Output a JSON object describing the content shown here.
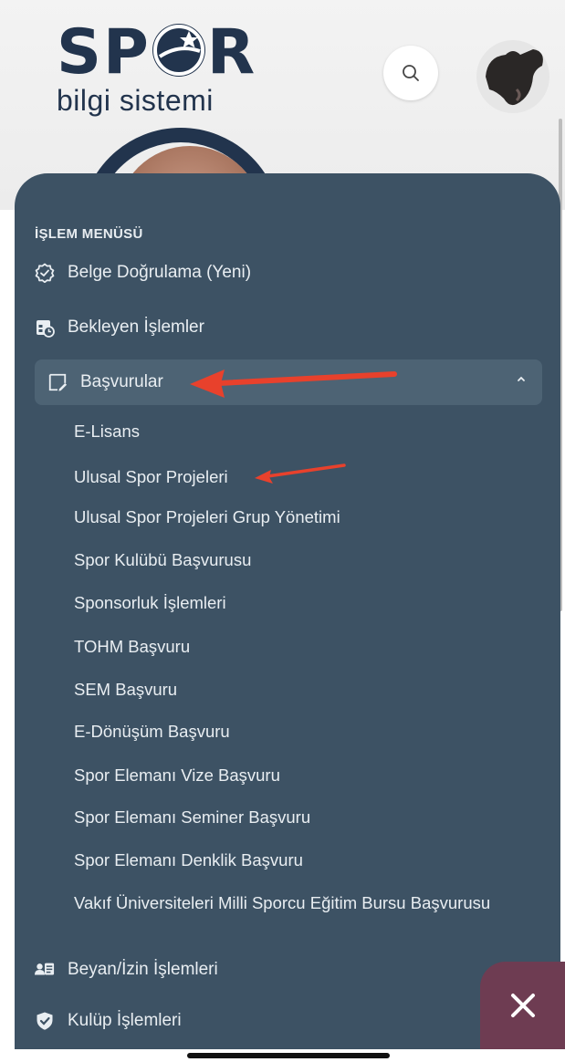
{
  "header": {
    "logo_title": "SP R",
    "logo_subtitle": "bilgi sistemi"
  },
  "menu": {
    "section_title": "İŞLEM MENÜSÜ",
    "items": [
      {
        "label": "Belge Doğrulama (Yeni)",
        "icon": "badge-check-icon"
      },
      {
        "label": "Bekleyen İşlemler",
        "icon": "calendar-clock-icon"
      },
      {
        "label": "Başvurular",
        "icon": "form-edit-icon",
        "expanded": true
      }
    ],
    "subitems": [
      "E-Lisans",
      "Ulusal Spor Projeleri",
      "Ulusal Spor Projeleri Grup Yönetimi",
      "Spor Kulübü Başvurusu",
      "Sponsorluk İşlemleri",
      "TOHM Başvuru",
      "SEM Başvuru",
      "E-Dönüşüm Başvuru",
      "Spor Elemanı Vize Başvuru",
      "Spor Elemanı Seminer Başvuru",
      "Spor Elemanı Denklik Başvuru",
      "Vakıf Üniversiteleri Milli Sporcu Eğitim Bursu Başvurusu"
    ],
    "more_items": [
      {
        "label": "Beyan/İzin İşlemleri",
        "icon": "user-card-icon"
      },
      {
        "label": "Kulüp İşlemleri",
        "icon": "shield-check-icon"
      }
    ]
  },
  "colors": {
    "menu_bg": "#3d5264",
    "active_bg": "#4d6374",
    "brand": "#22344d",
    "close_fab": "#6e3c52",
    "annotation_arrow": "#e8412c"
  }
}
